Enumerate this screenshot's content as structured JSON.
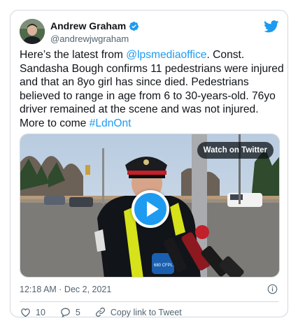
{
  "author": {
    "name": "Andrew Graham",
    "handle": "@andrewjwgraham"
  },
  "tweet": {
    "part1": "Here’s the latest from ",
    "mention": "@lpsmediaoffice",
    "part2": ". Const. Sandasha Bough confirms 11 pedestrians were injured and that an 8yo girl has since died. Pedestrians believed to range in age from 6 to 30-years-old. 76yo driver remained at the scene and was not injured. More to come ",
    "hashtag": "#LdnOnt"
  },
  "media": {
    "watch_label": "Watch on Twitter",
    "mic_label": "680 CFPL"
  },
  "timestamp": "12:18 AM · Dec 2, 2021",
  "actions": {
    "likes": "10",
    "replies": "5",
    "copy_link": "Copy link to Tweet"
  },
  "colors": {
    "accent": "#1d9bf0",
    "text": "#0f1419",
    "muted": "#536471"
  }
}
